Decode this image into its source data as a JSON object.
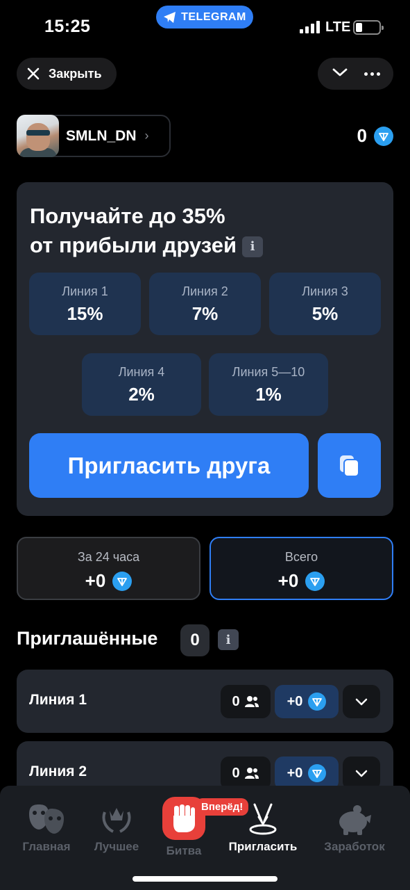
{
  "status_bar": {
    "time": "15:25",
    "network": "LTE",
    "app_pill": "TELEGRAM"
  },
  "top_bar": {
    "close_label": "Закрыть"
  },
  "user": {
    "username": "SMLN_DN",
    "balance": "0"
  },
  "referral": {
    "title_line1": "Получайте до 35%",
    "title_line2": "от прибыли друзей",
    "info_glyph": "i",
    "lines": [
      {
        "label": "Линия 1",
        "value": "15%"
      },
      {
        "label": "Линия 2",
        "value": "7%"
      },
      {
        "label": "Линия 3",
        "value": "5%"
      },
      {
        "label": "Линия 4",
        "value": "2%"
      },
      {
        "label": "Линия 5—10",
        "value": "1%"
      }
    ],
    "invite_label": "Пригласить друга"
  },
  "stats": [
    {
      "label": "За 24 часа",
      "value": "+0"
    },
    {
      "label": "Всего",
      "value": "+0"
    }
  ],
  "invited": {
    "title": "Приглашённые",
    "count": "0",
    "rows": [
      {
        "name": "Линия 1",
        "count": "0",
        "earned": "+0"
      },
      {
        "name": "Линия 2",
        "count": "0",
        "earned": "+0"
      }
    ]
  },
  "nav": {
    "items": [
      {
        "label": "Главная",
        "icon": "masks-icon"
      },
      {
        "label": "Лучшее",
        "icon": "laurel-crown-icon"
      },
      {
        "label": "Битва",
        "icon": "fist-icon"
      },
      {
        "label": "Пригласить",
        "icon": "invite-icon"
      },
      {
        "label": "Заработок",
        "icon": "piggy-bank-icon"
      }
    ],
    "battle_badge": "Вперёд!"
  },
  "colors": {
    "accent": "#2f7ef5",
    "ton": "#2b9ff0",
    "battle": "#e8403a",
    "card": "#23272f"
  }
}
